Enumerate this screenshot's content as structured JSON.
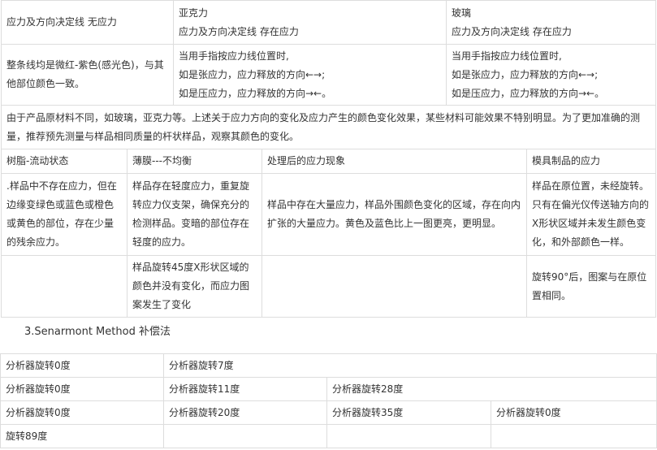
{
  "table1": {
    "row1": {
      "c1": "应力及方向决定线 无应力",
      "c2_title": "亚克力",
      "c2_text": "应力及方向决定线 存在应力",
      "c3_title": "玻璃",
      "c3_text": "应力及方向决定线 存在应力"
    },
    "row2": {
      "c1": "整条线均是微红-紫色(感光色)，与其他部位颜色一致。",
      "c2_line1": "当用手指按应力线位置时,",
      "c2_line2": "如是张应力，应力释放的方向←→;",
      "c2_line3": "如是压应力，应力释放的方向→←。",
      "c3_line1": "当用手指按应力线位置时,",
      "c3_line2": "如是张应力，应力释放的方向←→;",
      "c3_line3": "如是压应力，应力释放的方向→←。"
    },
    "note": "由于产品原材料不同，如玻璃，亚克力等。上述关于应力方向的变化及应力产生的颜色变化效果，某些材料可能效果不特别明显。为了更加准确的测量，推荐预先测量与样品相同质量的杆状样品，观察其颜色的变化。"
  },
  "table2": {
    "headers": [
      "树脂-流动状态",
      "薄膜---不均衡",
      "处理后的应力现象",
      "模具制品的应力"
    ],
    "row1": {
      "c1": ".样品中不存在应力，但在边缘变绿色或蓝色或橙色或黄色的部位，存在少量的残余应力。",
      "c2": "样品存在轻度应力，重复旋转应力仪支架，确保充分的检测样品。变暗的部位存在轻度的应力。",
      "c3": "样品中存在大量应力，样品外围颜色变化的区域，存在向内扩张的大量应力。黄色及蓝色比上一图更亮，更明显。",
      "c4": "样品在原位置，未经旋转。只有在偏光仪传送轴方向的X形状区域并未发生颜色变化，和外部颜色一样。"
    },
    "row2": {
      "c1": "",
      "c2": "样品旋转45度X形状区域的颜色并没有变化，而应力图案发生了变化",
      "c3": "",
      "c4": "旋转90°后，图案与在原位置相同。"
    }
  },
  "heading": "3.Senarmont Method 补偿法",
  "table3": {
    "row1": [
      "分析器旋转0度",
      "分析器旋转7度"
    ],
    "row2": [
      "分析器旋转0度",
      "分析器旋转11度",
      "分析器旋转28度"
    ],
    "row3": [
      "分析器旋转0度",
      "分析器旋转20度",
      "分析器旋转35度",
      "分析器旋转0度"
    ],
    "row4": [
      "旋转89度",
      "",
      "",
      ""
    ]
  }
}
